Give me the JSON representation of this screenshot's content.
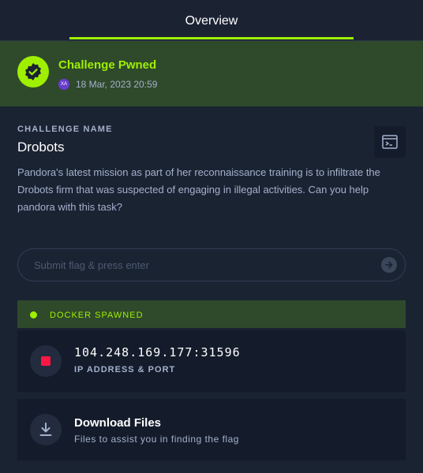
{
  "tabs": {
    "overview_label": "Overview"
  },
  "pwned": {
    "title": "Challenge Pwned",
    "avatar_initials": "XA",
    "date": "18 Mar, 2023 20:59"
  },
  "challenge": {
    "section_label": "CHALLENGE NAME",
    "name": "Drobots",
    "description": "Pandora's latest mission as part of her reconnaissance training is to infiltrate the Drobots firm that was suspected of engaging in illegal activities. Can you help pandora with this task?"
  },
  "flag": {
    "placeholder": "Submit flag & press enter"
  },
  "docker": {
    "status": "DOCKER SPAWNED"
  },
  "instance": {
    "address": "104.248.169.177:31596",
    "label": "IP ADDRESS & PORT"
  },
  "download": {
    "title": "Download Files",
    "subtitle": "Files to assist you in finding the flag"
  },
  "colors": {
    "accent": "#9fef00",
    "background": "#1a2332",
    "card": "#141c2b",
    "stop": "#ff1744"
  }
}
